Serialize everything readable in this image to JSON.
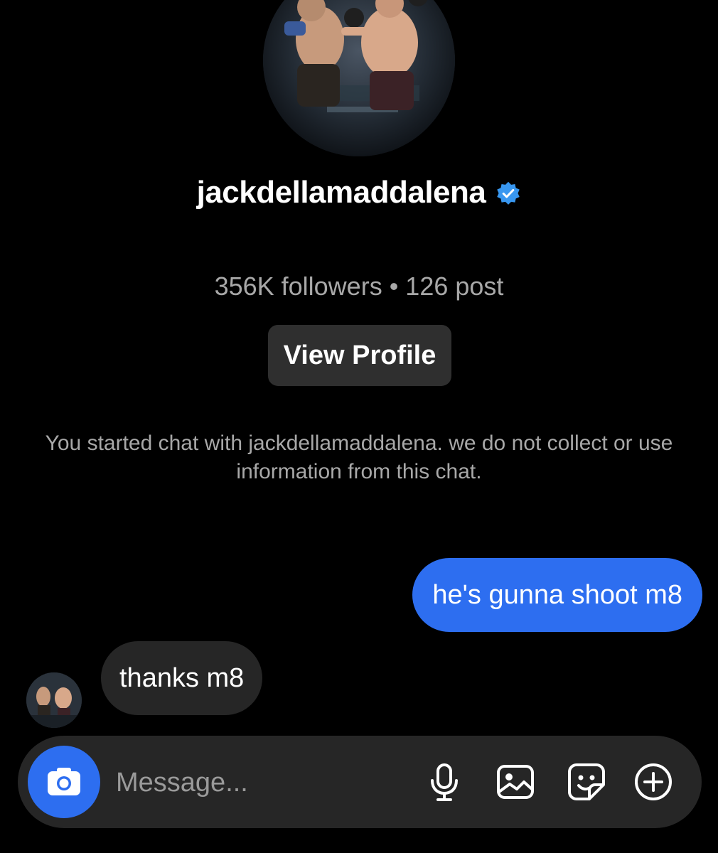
{
  "profile": {
    "username": "jackdellamaddalena",
    "verified": true,
    "stats": "356K followers • 126 post",
    "view_profile_label": "View Profile"
  },
  "notice": "You started chat with jackdellamaddalena. we do not collect or use information from this chat.",
  "messages": [
    {
      "direction": "outgoing",
      "text": "he's gunna shoot m8"
    },
    {
      "direction": "incoming",
      "text": "thanks m8"
    }
  ],
  "composer": {
    "placeholder": "Message...",
    "icons": [
      "camera-icon",
      "microphone-icon",
      "gallery-icon",
      "sticker-icon",
      "add-icon"
    ]
  },
  "colors": {
    "background": "#000000",
    "accent": "#2d6ef0",
    "incoming_bubble": "#262626",
    "secondary_text": "#a8a8a8",
    "verified_badge": "#3897f0"
  }
}
